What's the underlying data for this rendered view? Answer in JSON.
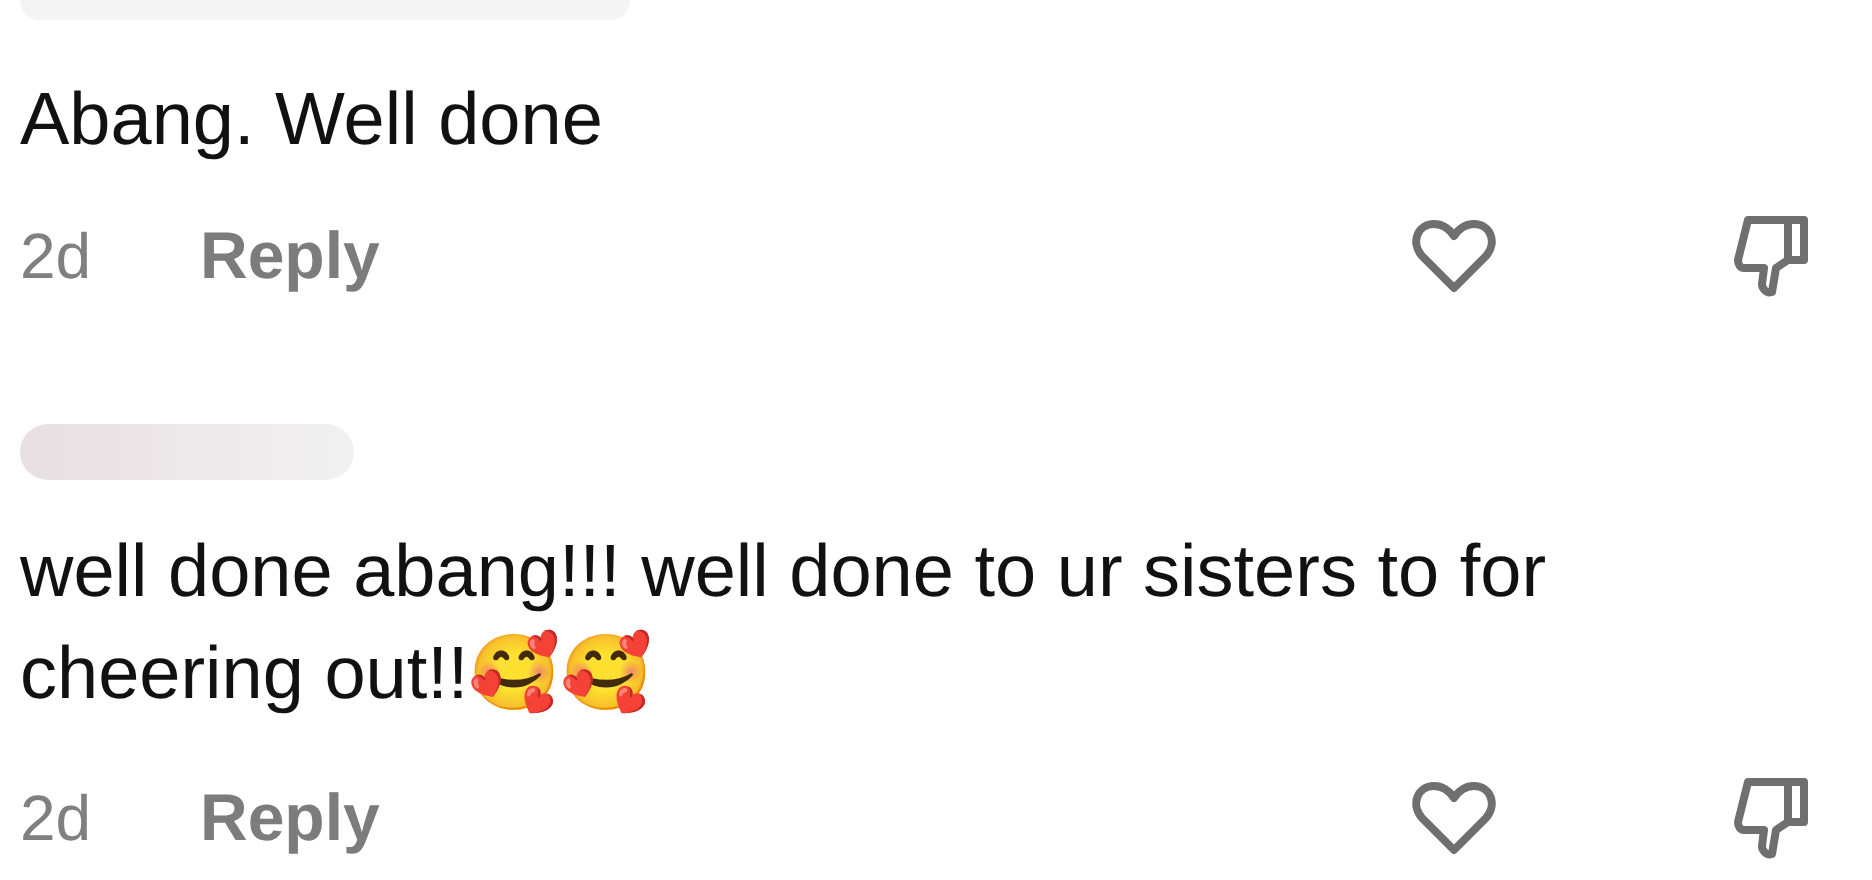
{
  "comments": [
    {
      "text": "Abang. Well done",
      "time": "2d",
      "reply": "Reply",
      "liked": false,
      "disliked": false,
      "name_redacted": true
    },
    {
      "text": "well done abang!!! well done to ur sisters to for cheering out!!🥰🥰",
      "time": "2d",
      "reply": "Reply",
      "liked": false,
      "disliked": false,
      "name_redacted": true
    }
  ]
}
